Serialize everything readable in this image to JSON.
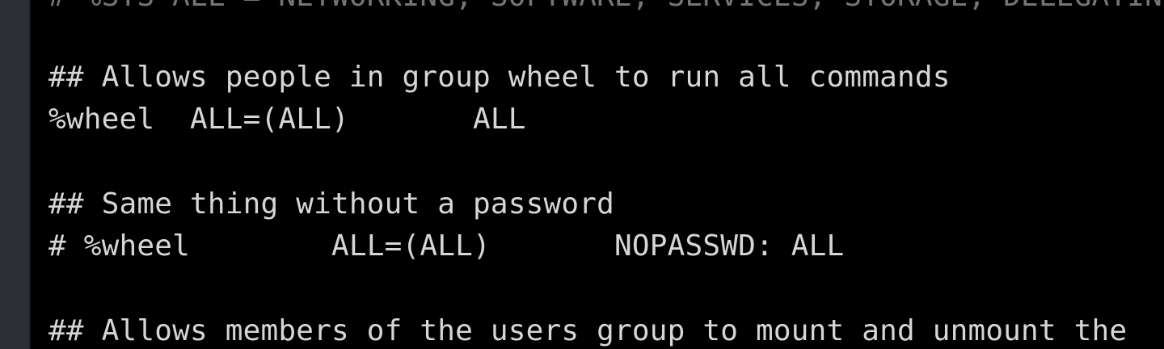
{
  "terminal": {
    "lines": [
      "# %SYS ALL = NETWORKING, SOFTWARE, SERVICES, STORAGE, DELEGATING",
      "## Allows people in group wheel to run all commands",
      "%wheel  ALL=(ALL)       ALL",
      "## Same thing without a password",
      "# %wheel        ALL=(ALL)       NOPASSWD: ALL",
      "## Allows members of the users group to mount and unmount the"
    ]
  },
  "colors": {
    "background": "#000000",
    "text": "#d6d6d6",
    "sidebar": "#2b2f33"
  }
}
